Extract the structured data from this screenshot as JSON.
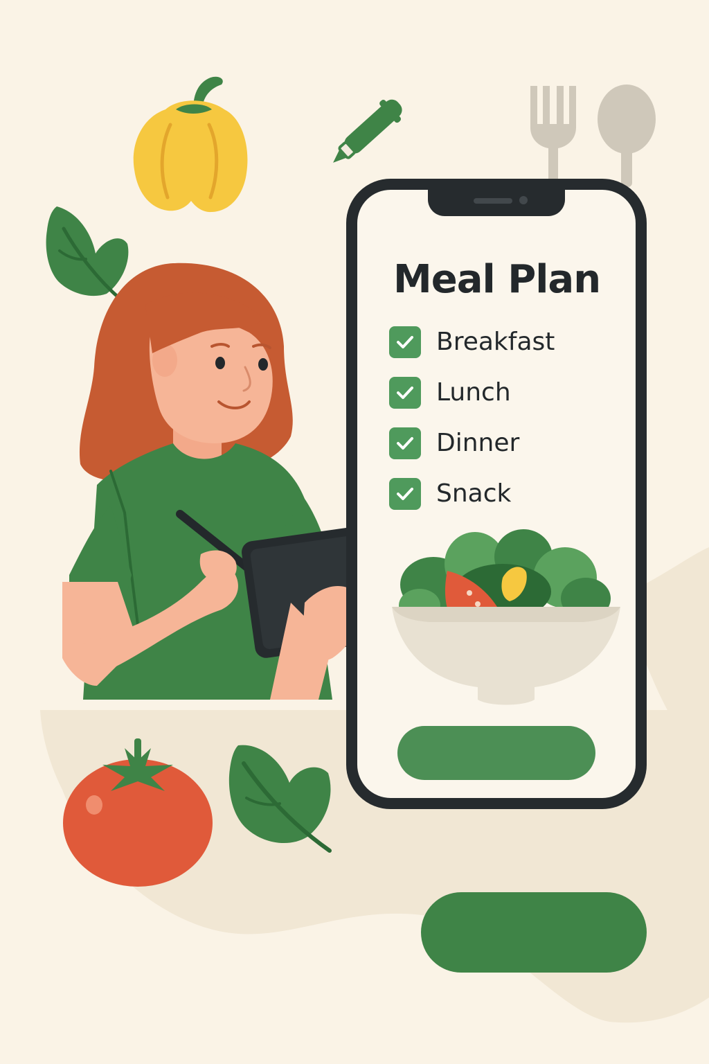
{
  "app": {
    "title": "Meal Plan",
    "checklist": [
      {
        "label": "Breakfast",
        "checked": true
      },
      {
        "label": "Lunch",
        "checked": true
      },
      {
        "label": "Dinner",
        "checked": true
      },
      {
        "label": "Snack",
        "checked": true
      }
    ],
    "primary_button_label": "",
    "illustration_icon": "salad-bowl-icon"
  },
  "page": {
    "bottom_button_label": "",
    "decorations": [
      "bell-pepper-icon",
      "pen-icon",
      "fork-icon",
      "spoon-icon",
      "leaf-icon",
      "tomato-icon",
      "woman-with-tablet-illustration"
    ]
  },
  "colors": {
    "background": "#FAF3E6",
    "accent_green": "#4C8F55",
    "button_green": "#3F8447",
    "phone_frame": "#262B2E",
    "text_dark": "#23282B",
    "tomato_red": "#E05A3A",
    "pepper_yellow": "#F6C840",
    "hair_orange": "#C65B32"
  }
}
